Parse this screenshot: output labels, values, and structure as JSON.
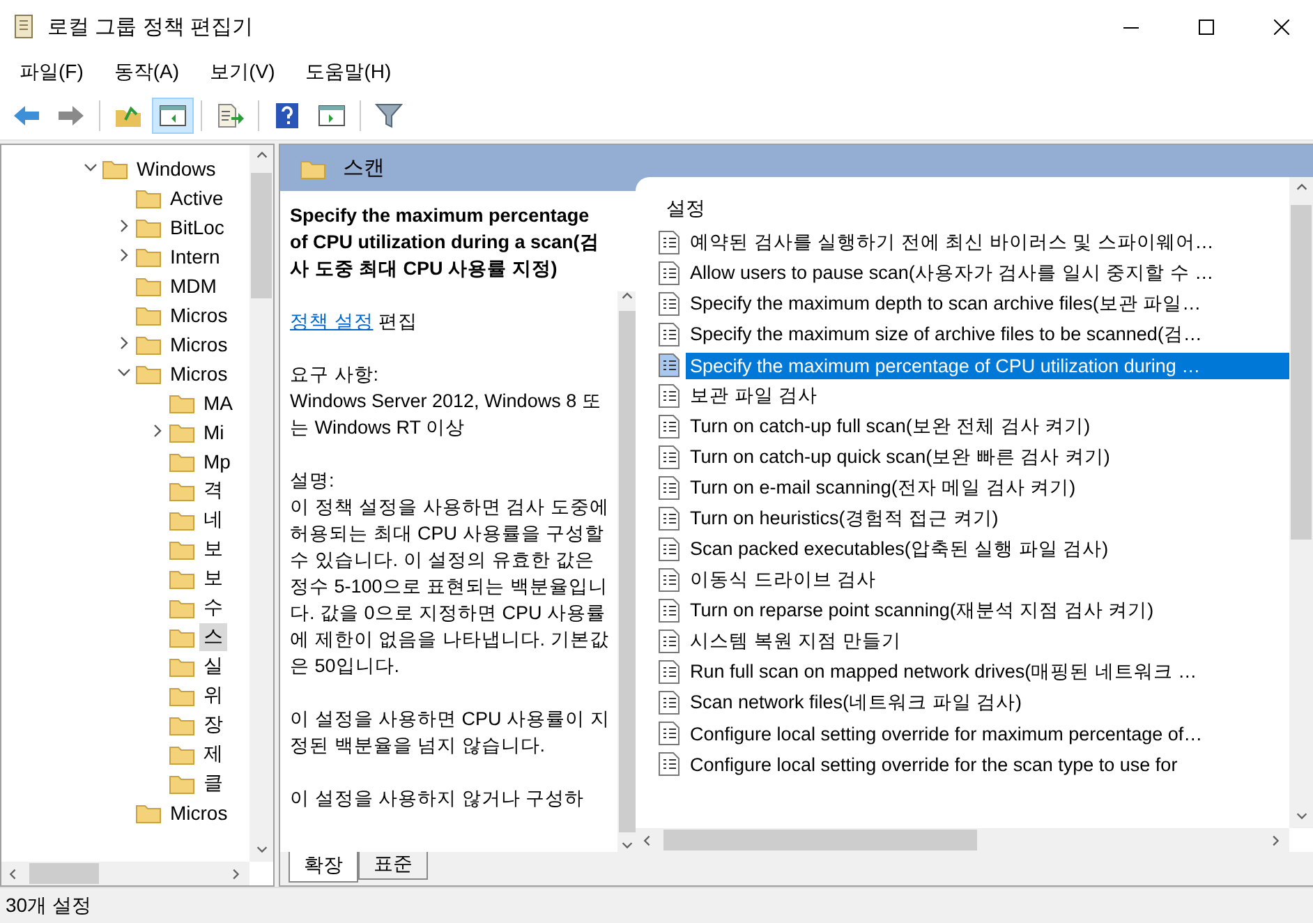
{
  "window": {
    "title": "로컬 그룹 정책 편집기"
  },
  "menu": [
    "파일(F)",
    "동작(A)",
    "보기(V)",
    "도움말(H)"
  ],
  "toolbar": [
    [
      {
        "kind": "back",
        "pressed": false
      },
      {
        "kind": "forward",
        "pressed": false
      }
    ],
    [
      {
        "kind": "up",
        "pressed": false
      },
      {
        "kind": "tree",
        "pressed": true
      }
    ],
    [
      {
        "kind": "export",
        "pressed": false
      }
    ],
    [
      {
        "kind": "help",
        "pressed": false
      },
      {
        "kind": "pane",
        "pressed": false
      }
    ],
    [
      {
        "kind": "filter",
        "pressed": false
      }
    ]
  ],
  "tree": [
    {
      "label": "Windows",
      "expanded": true,
      "selected": false,
      "children": [
        {
          "label": "Active",
          "selected": false
        },
        {
          "label": "BitLoc",
          "expanded": false,
          "selected": false
        },
        {
          "label": "Intern",
          "expanded": false,
          "selected": false
        },
        {
          "label": "MDM",
          "selected": false
        },
        {
          "label": "Micros",
          "selected": false
        },
        {
          "label": "Micros",
          "expanded": false,
          "selected": false
        },
        {
          "label": "Micros",
          "expanded": true,
          "selected": false,
          "children": [
            {
              "label": "MA",
              "selected": false
            },
            {
              "label": "Mi",
              "expanded": false,
              "selected": false
            },
            {
              "label": "Mp",
              "selected": false
            },
            {
              "label": "격",
              "selected": false
            },
            {
              "label": "네",
              "selected": false
            },
            {
              "label": "보",
              "selected": false
            },
            {
              "label": "보",
              "selected": false
            },
            {
              "label": "수",
              "selected": false
            },
            {
              "label": "스",
              "selected": true
            },
            {
              "label": "실",
              "selected": false
            },
            {
              "label": "위",
              "selected": false
            },
            {
              "label": "장",
              "selected": false
            },
            {
              "label": "제",
              "selected": false
            },
            {
              "label": "클",
              "selected": false
            }
          ]
        },
        {
          "label": "Micros",
          "selected": false
        }
      ]
    }
  ],
  "header": {
    "title": "스캔"
  },
  "description": {
    "title": "Specify the maximum percentage of CPU utilization during a scan(검사 도중 최대 CPU 사용률 지정)",
    "link": "정책 설정",
    "link_suffix": "편집",
    "requirements_label": "요구 사항:",
    "requirements": "Windows Server 2012, Windows 8 또는 Windows RT 이상",
    "explain_label": "설명:",
    "paragraphs": [
      "이 정책 설정을 사용하면 검사 도중에 허용되는 최대 CPU 사용률을 구성할 수 있습니다. 이 설정의 유효한 값은 정수 5-100으로 표현되는 백분율입니다. 값을 0으로 지정하면 CPU 사용률에 제한이 없음을 나타냅니다. 기본값은 50입니다.",
      "이 설정을 사용하면 CPU 사용률이 지정된 백분율을 넘지 않습니다.",
      "이 설정을 사용하지 않거나 구성하"
    ]
  },
  "settings": {
    "column": "설정",
    "items": [
      {
        "label": "예약된 검사를 실행하기 전에 최신 바이러스 및 스파이웨어…",
        "selected": false
      },
      {
        "label": "Allow users to pause scan(사용자가 검사를 일시 중지할 수 …",
        "selected": false
      },
      {
        "label": "Specify the maximum depth to scan archive files(보관 파일…",
        "selected": false
      },
      {
        "label": "Specify the maximum size of archive files to be scanned(검…",
        "selected": false
      },
      {
        "label": "Specify the maximum percentage of CPU utilization during …",
        "selected": true
      },
      {
        "label": "보관 파일 검사",
        "selected": false
      },
      {
        "label": "Turn on catch-up full scan(보완 전체 검사 켜기)",
        "selected": false
      },
      {
        "label": "Turn on catch-up quick scan(보완 빠른 검사 켜기)",
        "selected": false
      },
      {
        "label": "Turn on e-mail scanning(전자 메일 검사 켜기)",
        "selected": false
      },
      {
        "label": "Turn on heuristics(경험적 접근 켜기)",
        "selected": false
      },
      {
        "label": "Scan packed executables(압축된 실행 파일 검사)",
        "selected": false
      },
      {
        "label": "이동식 드라이브 검사",
        "selected": false
      },
      {
        "label": "Turn on reparse point scanning(재분석 지점 검사 켜기)",
        "selected": false
      },
      {
        "label": "시스템 복원 지점 만들기",
        "selected": false
      },
      {
        "label": "Run full scan on mapped network drives(매핑된 네트워크 …",
        "selected": false
      },
      {
        "label": "Scan network files(네트워크 파일 검사)",
        "selected": false
      },
      {
        "label": "Configure local setting override for maximum percentage of…",
        "selected": false
      },
      {
        "label": "Configure local setting override for the scan type to use for",
        "selected": false
      }
    ]
  },
  "tabs": [
    {
      "label": "확장",
      "selected": true
    },
    {
      "label": "표준",
      "selected": false
    }
  ],
  "status_bar": "30개 설정"
}
